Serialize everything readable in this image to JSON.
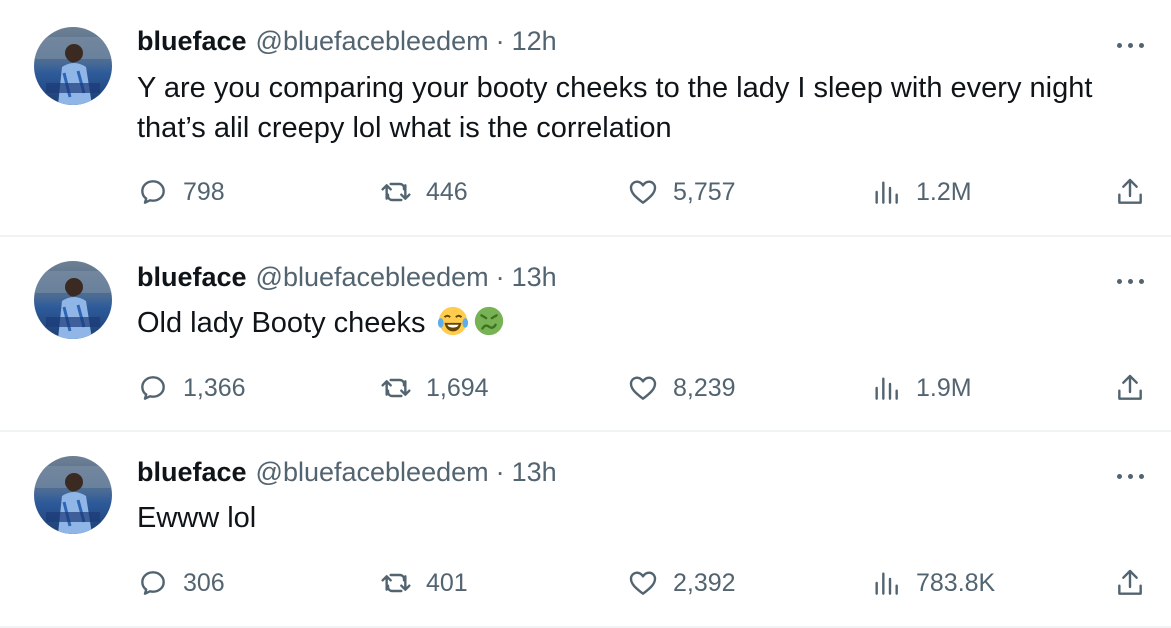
{
  "tweets": [
    {
      "author": {
        "name": "blueface",
        "handle": "@bluefacebleedem"
      },
      "separator": "·",
      "time": "12h",
      "text_lines": [
        "Y are you comparing your booty cheeks to the lady I sleep with every night",
        "that’s alil creepy lol what is the correlation"
      ],
      "actions": {
        "replies": "798",
        "retweets": "446",
        "likes": "5,757",
        "views": "1.2M"
      }
    },
    {
      "author": {
        "name": "blueface",
        "handle": "@bluefacebleedem"
      },
      "separator": "·",
      "time": "13h",
      "text_lines": [
        "Old lady Booty cheeks"
      ],
      "emojis": [
        "face-with-tears-of-joy",
        "nauseated-face"
      ],
      "actions": {
        "replies": "1,366",
        "retweets": "1,694",
        "likes": "8,239",
        "views": "1.9M"
      }
    },
    {
      "author": {
        "name": "blueface",
        "handle": "@bluefacebleedem"
      },
      "separator": "·",
      "time": "13h",
      "text_lines": [
        "Ewww lol"
      ],
      "actions": {
        "replies": "306",
        "retweets": "401",
        "likes": "2,392",
        "views": "783.8K"
      }
    }
  ],
  "icons": {
    "reply": "reply-icon",
    "retweet": "retweet-icon",
    "like": "heart-icon",
    "views": "views-icon",
    "share": "share-icon",
    "more": "more-icon"
  },
  "colors": {
    "text": "#0f1419",
    "secondary": "#536471",
    "divider": "#eff3f4"
  }
}
